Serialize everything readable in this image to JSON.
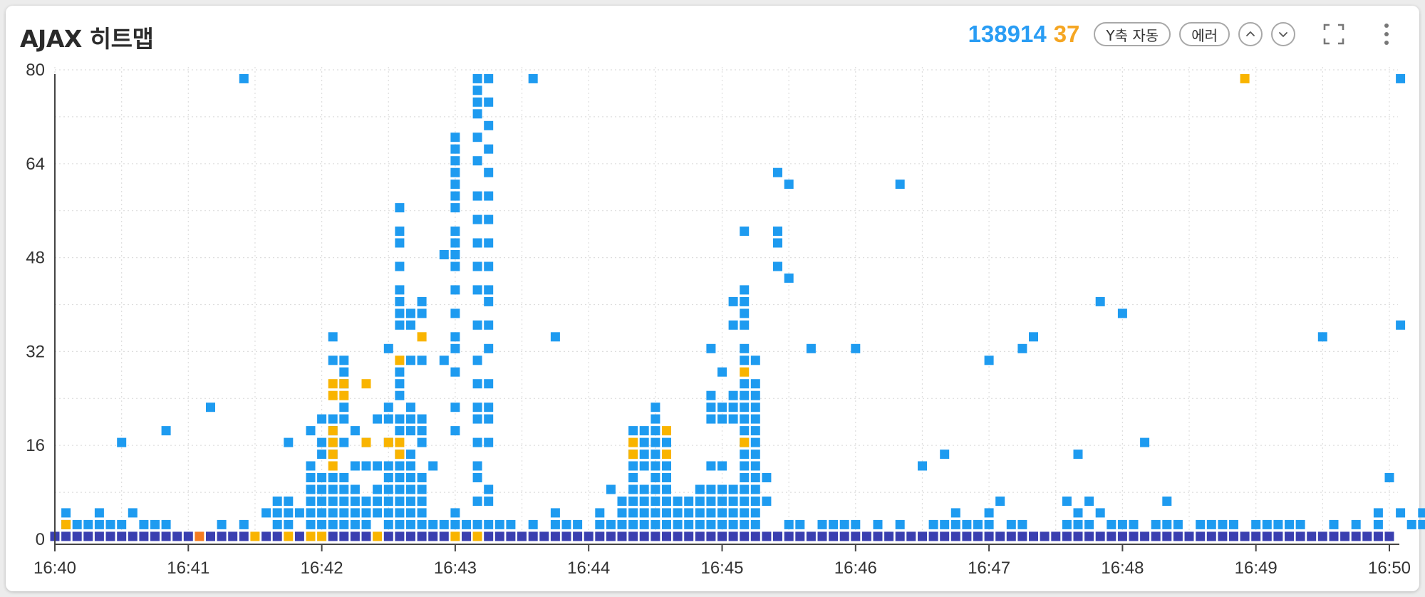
{
  "header": {
    "title": "AJAX 히트맵",
    "count_normal": "138914",
    "count_error": "37",
    "y_axis_button": "Y축 자동",
    "error_button": "에러"
  },
  "icons": {
    "up": "chevron-up-icon",
    "down": "chevron-down-icon",
    "fullscreen": "fullscreen-icon",
    "more": "more-vertical-icon"
  },
  "colors": {
    "normal_low": "#3a3fb0",
    "normal_high": "#1e9bf0",
    "error": "#f9b400",
    "error_strong": "#f47b20"
  },
  "chart_data": {
    "type": "heatmap",
    "title": "",
    "xlabel": "",
    "ylabel": "",
    "x_ticks": [
      "16:40",
      "16:41",
      "16:42",
      "16:43",
      "16:44",
      "16:45",
      "16:46",
      "16:47",
      "16:48",
      "16:49",
      "16:50"
    ],
    "y_ticks": [
      0,
      16,
      32,
      48,
      64,
      80
    ],
    "xlim": [
      "16:40:00",
      "16:50:00"
    ],
    "ylim": [
      0,
      80
    ],
    "grid": true,
    "cell_note": "columns = 5-second buckets; rows = response-time bins",
    "bottom_row_columns": "all",
    "normal_cells": [
      {
        "x": "16:40:05",
        "y": [
          2.5,
          4.5
        ]
      },
      {
        "x": "16:40:10",
        "y": [
          2.5
        ]
      },
      {
        "x": "16:40:15",
        "y": [
          2.5
        ]
      },
      {
        "x": "16:40:20",
        "y": [
          2.5,
          4.5
        ]
      },
      {
        "x": "16:40:25",
        "y": [
          2.5
        ]
      },
      {
        "x": "16:40:30",
        "y": [
          2.5,
          16.5
        ]
      },
      {
        "x": "16:40:35",
        "y": [
          4.5
        ]
      },
      {
        "x": "16:40:40",
        "y": [
          2.5
        ]
      },
      {
        "x": "16:40:45",
        "y": [
          2.5
        ]
      },
      {
        "x": "16:40:50",
        "y": [
          2.5,
          18.5
        ]
      },
      {
        "x": "16:41:10",
        "y": [
          22.5
        ]
      },
      {
        "x": "16:41:15",
        "y": [
          2.5
        ]
      },
      {
        "x": "16:41:25",
        "y": [
          2.5,
          78.5
        ]
      },
      {
        "x": "16:41:35",
        "y": [
          4.5
        ]
      },
      {
        "x": "16:41:40",
        "y": [
          2.5,
          4.5,
          6.5
        ]
      },
      {
        "x": "16:41:45",
        "y": [
          2.5,
          4.5,
          6.5,
          16.5
        ]
      },
      {
        "x": "16:41:50",
        "y": [
          4.5
        ]
      },
      {
        "x": "16:41:55",
        "y": [
          2.5,
          4.5,
          6.5,
          8.5,
          10.5,
          12.5,
          18.5
        ]
      },
      {
        "x": "16:42:00",
        "y": [
          2.5,
          4.5,
          6.5,
          8.5,
          10.5,
          14.5,
          16.5,
          20.5
        ]
      },
      {
        "x": "16:42:05",
        "y": [
          2.5,
          4.5,
          6.5,
          8.5,
          10.5,
          14.5,
          16.5,
          18.5,
          20.5,
          30.5,
          34.5
        ]
      },
      {
        "x": "16:42:10",
        "y": [
          2.5,
          4.5,
          6.5,
          8.5,
          10.5,
          16.5,
          20.5,
          22.5,
          26.5,
          28.5,
          30.5
        ]
      },
      {
        "x": "16:42:15",
        "y": [
          2.5,
          4.5,
          6.5,
          8.5,
          12.5,
          18.5
        ]
      },
      {
        "x": "16:42:20",
        "y": [
          2.5,
          4.5,
          6.5,
          12.5,
          16.5
        ]
      },
      {
        "x": "16:42:25",
        "y": [
          4.5,
          6.5,
          8.5,
          12.5,
          20.5
        ]
      },
      {
        "x": "16:42:30",
        "y": [
          2.5,
          4.5,
          6.5,
          8.5,
          10.5,
          12.5,
          16.5,
          20.5,
          22.5,
          32.5
        ]
      },
      {
        "x": "16:42:35",
        "y": [
          2.5,
          4.5,
          6.5,
          8.5,
          10.5,
          12.5,
          14.5,
          18.5,
          20.5,
          24.5,
          26.5,
          28.5,
          36.5,
          38.5,
          40.5,
          42.5,
          46.5,
          50.5,
          52.5,
          56.5
        ]
      },
      {
        "x": "16:42:40",
        "y": [
          2.5,
          4.5,
          6.5,
          8.5,
          10.5,
          12.5,
          14.5,
          18.5,
          20.5,
          22.5,
          30.5,
          36.5,
          38.5
        ]
      },
      {
        "x": "16:42:45",
        "y": [
          2.5,
          4.5,
          6.5,
          8.5,
          10.5,
          16.5,
          18.5,
          20.5,
          30.5,
          38.5,
          40.5
        ]
      },
      {
        "x": "16:42:50",
        "y": [
          2.5,
          12.5
        ]
      },
      {
        "x": "16:42:55",
        "y": [
          2.5,
          30.5,
          48.5
        ]
      },
      {
        "x": "16:43:00",
        "y": [
          2.5,
          4.5,
          18.5,
          22.5,
          28.5,
          32.5,
          34.5,
          38.5,
          42.5,
          46.5,
          48.5,
          50.5,
          52.5,
          56.5,
          58.5,
          60.5,
          62.5,
          64.5,
          66.5,
          68.5
        ]
      },
      {
        "x": "16:43:05",
        "y": [
          2.5
        ]
      },
      {
        "x": "16:43:10",
        "y": [
          2.5,
          6.5,
          10.5,
          12.5,
          16.5,
          20.5,
          22.5,
          26.5,
          30.5,
          36.5,
          42.5,
          46.5,
          50.5,
          54.5,
          58.5,
          64.5,
          68.5,
          72.5,
          74.5,
          76.5,
          78.5
        ]
      },
      {
        "x": "16:43:15",
        "y": [
          2.5,
          6.5,
          8.5,
          16.5,
          20.5,
          22.5,
          26.5,
          32.5,
          36.5,
          40.5,
          42.5,
          46.5,
          50.5,
          54.5,
          58.5,
          62.5,
          66.5,
          70.5,
          74.5,
          78.5
        ]
      },
      {
        "x": "16:43:20",
        "y": [
          2.5
        ]
      },
      {
        "x": "16:43:25",
        "y": [
          2.5
        ]
      },
      {
        "x": "16:43:35",
        "y": [
          2.5,
          78.5
        ]
      },
      {
        "x": "16:43:45",
        "y": [
          2.5,
          4.5,
          34.5
        ]
      },
      {
        "x": "16:43:50",
        "y": [
          2.5
        ]
      },
      {
        "x": "16:43:55",
        "y": [
          2.5
        ]
      },
      {
        "x": "16:44:05",
        "y": [
          2.5,
          4.5
        ]
      },
      {
        "x": "16:44:10",
        "y": [
          2.5,
          8.5
        ]
      },
      {
        "x": "16:44:15",
        "y": [
          2.5,
          4.5,
          6.5
        ]
      },
      {
        "x": "16:44:20",
        "y": [
          2.5,
          4.5,
          6.5,
          8.5,
          10.5,
          12.5,
          14.5,
          18.5
        ]
      },
      {
        "x": "16:44:25",
        "y": [
          2.5,
          4.5,
          6.5,
          8.5,
          12.5,
          14.5,
          16.5,
          18.5
        ]
      },
      {
        "x": "16:44:30",
        "y": [
          2.5,
          4.5,
          6.5,
          8.5,
          10.5,
          12.5,
          14.5,
          16.5,
          18.5,
          20.5,
          22.5
        ]
      },
      {
        "x": "16:44:35",
        "y": [
          2.5,
          4.5,
          6.5,
          8.5,
          10.5,
          12.5,
          16.5
        ]
      },
      {
        "x": "16:44:40",
        "y": [
          2.5,
          4.5,
          6.5
        ]
      },
      {
        "x": "16:44:45",
        "y": [
          2.5,
          4.5,
          6.5
        ]
      },
      {
        "x": "16:44:50",
        "y": [
          2.5,
          4.5,
          6.5,
          8.5
        ]
      },
      {
        "x": "16:44:55",
        "y": [
          2.5,
          4.5,
          6.5,
          8.5,
          12.5,
          20.5,
          22.5,
          24.5,
          32.5
        ]
      },
      {
        "x": "16:45:00",
        "y": [
          2.5,
          4.5,
          6.5,
          8.5,
          12.5,
          20.5,
          22.5,
          28.5
        ]
      },
      {
        "x": "16:45:05",
        "y": [
          2.5,
          4.5,
          6.5,
          8.5,
          20.5,
          22.5,
          24.5,
          36.5,
          40.5
        ]
      },
      {
        "x": "16:45:10",
        "y": [
          2.5,
          4.5,
          6.5,
          8.5,
          10.5,
          12.5,
          14.5,
          16.5,
          18.5,
          20.5,
          22.5,
          24.5,
          26.5,
          30.5,
          32.5,
          36.5,
          38.5,
          40.5,
          42.5,
          52.5
        ]
      },
      {
        "x": "16:45:15",
        "y": [
          2.5,
          4.5,
          6.5,
          8.5,
          10.5,
          12.5,
          14.5,
          16.5,
          18.5,
          20.5,
          22.5,
          24.5,
          26.5,
          30.5
        ]
      },
      {
        "x": "16:45:20",
        "y": [
          6.5,
          10.5
        ]
      },
      {
        "x": "16:45:25",
        "y": [
          46.5,
          50.5,
          52.5,
          62.5
        ]
      },
      {
        "x": "16:45:30",
        "y": [
          2.5,
          44.5,
          60.5
        ]
      },
      {
        "x": "16:45:35",
        "y": [
          2.5
        ]
      },
      {
        "x": "16:45:40",
        "y": [
          32.5
        ]
      },
      {
        "x": "16:45:45",
        "y": [
          2.5
        ]
      },
      {
        "x": "16:45:50",
        "y": [
          2.5
        ]
      },
      {
        "x": "16:45:55",
        "y": [
          2.5
        ]
      },
      {
        "x": "16:46:00",
        "y": [
          2.5,
          32.5
        ]
      },
      {
        "x": "16:46:10",
        "y": [
          2.5
        ]
      },
      {
        "x": "16:46:20",
        "y": [
          2.5,
          60.5
        ]
      },
      {
        "x": "16:46:30",
        "y": [
          12.5
        ]
      },
      {
        "x": "16:46:35",
        "y": [
          2.5
        ]
      },
      {
        "x": "16:46:40",
        "y": [
          2.5,
          14.5
        ]
      },
      {
        "x": "16:46:45",
        "y": [
          2.5,
          4.5
        ]
      },
      {
        "x": "16:46:50",
        "y": [
          2.5
        ]
      },
      {
        "x": "16:46:55",
        "y": [
          2.5
        ]
      },
      {
        "x": "16:47:00",
        "y": [
          2.5,
          4.5,
          30.5
        ]
      },
      {
        "x": "16:47:05",
        "y": [
          6.5
        ]
      },
      {
        "x": "16:47:10",
        "y": [
          2.5
        ]
      },
      {
        "x": "16:47:15",
        "y": [
          2.5,
          32.5
        ]
      },
      {
        "x": "16:47:20",
        "y": [
          34.5
        ]
      },
      {
        "x": "16:47:35",
        "y": [
          2.5,
          6.5
        ]
      },
      {
        "x": "16:47:40",
        "y": [
          2.5,
          4.5,
          14.5
        ]
      },
      {
        "x": "16:47:45",
        "y": [
          2.5,
          6.5
        ]
      },
      {
        "x": "16:47:50",
        "y": [
          4.5,
          40.5
        ]
      },
      {
        "x": "16:47:55",
        "y": [
          2.5
        ]
      },
      {
        "x": "16:48:00",
        "y": [
          2.5,
          38.5
        ]
      },
      {
        "x": "16:48:05",
        "y": [
          2.5
        ]
      },
      {
        "x": "16:48:10",
        "y": [
          16.5
        ]
      },
      {
        "x": "16:48:15",
        "y": [
          2.5
        ]
      },
      {
        "x": "16:48:20",
        "y": [
          2.5,
          6.5
        ]
      },
      {
        "x": "16:48:25",
        "y": [
          2.5
        ]
      },
      {
        "x": "16:48:35",
        "y": [
          2.5
        ]
      },
      {
        "x": "16:48:40",
        "y": [
          2.5
        ]
      },
      {
        "x": "16:48:45",
        "y": [
          2.5
        ]
      },
      {
        "x": "16:48:50",
        "y": [
          2.5
        ]
      },
      {
        "x": "16:49:00",
        "y": [
          2.5
        ]
      },
      {
        "x": "16:49:05",
        "y": [
          2.5
        ]
      },
      {
        "x": "16:49:10",
        "y": [
          2.5
        ]
      },
      {
        "x": "16:49:15",
        "y": [
          2.5
        ]
      },
      {
        "x": "16:49:20",
        "y": [
          2.5
        ]
      },
      {
        "x": "16:49:30",
        "y": [
          34.5
        ]
      },
      {
        "x": "16:49:35",
        "y": [
          2.5
        ]
      },
      {
        "x": "16:49:45",
        "y": [
          2.5
        ]
      },
      {
        "x": "16:49:55",
        "y": [
          2.5,
          4.5
        ]
      },
      {
        "x": "16:50:00",
        "y": [
          10.5
        ]
      },
      {
        "x": "16:50:05",
        "y": [
          4.5,
          36.5,
          78.5
        ]
      },
      {
        "x": "16:50:10",
        "y": [
          2.5
        ]
      },
      {
        "x": "16:50:15",
        "y": [
          2.5,
          4.5
        ]
      }
    ],
    "error_cells": [
      {
        "x": "16:40:05",
        "y": [
          2.5
        ]
      },
      {
        "x": "16:41:05",
        "y": [
          0.5
        ],
        "strong": true
      },
      {
        "x": "16:41:30",
        "y": [
          0.5
        ]
      },
      {
        "x": "16:41:45",
        "y": [
          0.5
        ]
      },
      {
        "x": "16:41:55",
        "y": [
          0.5
        ]
      },
      {
        "x": "16:42:00",
        "y": [
          0.5
        ]
      },
      {
        "x": "16:42:05",
        "y": [
          12.5,
          14.5,
          16.5,
          18.5,
          24.5,
          26.5
        ]
      },
      {
        "x": "16:42:10",
        "y": [
          24.5,
          26.5
        ]
      },
      {
        "x": "16:42:20",
        "y": [
          16.5,
          26.5
        ]
      },
      {
        "x": "16:42:25",
        "y": [
          0.5
        ]
      },
      {
        "x": "16:42:30",
        "y": [
          16.5
        ]
      },
      {
        "x": "16:42:35",
        "y": [
          14.5,
          16.5,
          30.5
        ]
      },
      {
        "x": "16:42:45",
        "y": [
          34.5
        ]
      },
      {
        "x": "16:43:00",
        "y": [
          0.5
        ]
      },
      {
        "x": "16:43:10",
        "y": [
          0.5
        ]
      },
      {
        "x": "16:44:20",
        "y": [
          14.5,
          16.5
        ]
      },
      {
        "x": "16:44:35",
        "y": [
          14.5,
          18.5
        ]
      },
      {
        "x": "16:45:10",
        "y": [
          16.5,
          28.5
        ]
      },
      {
        "x": "16:48:55",
        "y": [
          78.5
        ]
      }
    ]
  }
}
